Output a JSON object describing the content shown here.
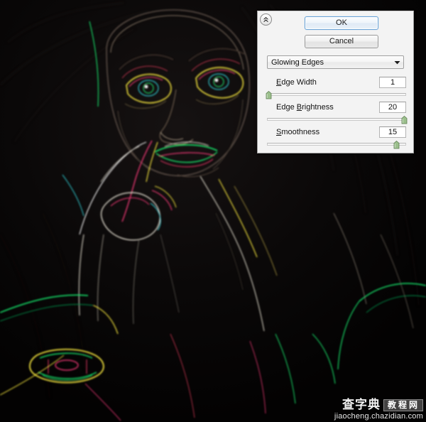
{
  "artwork": {
    "name": "glowing-edges-portrait",
    "description": "Dark portrait photo rendered with the Glowing Edges filter: neon outlines on a black background",
    "background_color": "#060505",
    "edge_colors": [
      "#19e36a",
      "#f2e23c",
      "#e0356e",
      "#4ad7e0",
      "#f27d1e",
      "#ffffff"
    ]
  },
  "watermark": {
    "brand_cn": "查字典",
    "tag_cn": "教程网",
    "url": "jiaocheng.chazidian.com"
  },
  "filter_dialog": {
    "collapse_icon": "double-chevron-up-icon",
    "buttons": {
      "ok_label": "OK",
      "cancel_label": "Cancel",
      "ok_accent_color": "#6ba3d6"
    },
    "filter_select": {
      "selected": "Glowing Edges",
      "arrow_icon": "chevron-down-icon"
    },
    "controls": [
      {
        "id": "edge-width",
        "label_before": "",
        "label_accel": "E",
        "label_after": "dge Width",
        "label_full": "Edge Width",
        "value": "1",
        "slider_percent": 1,
        "min": 1,
        "max": 14
      },
      {
        "id": "edge-brightness",
        "label_before": "Edge ",
        "label_accel": "B",
        "label_after": "rightness",
        "label_full": "Edge Brightness",
        "value": "20",
        "slider_percent": 99,
        "min": 0,
        "max": 20
      },
      {
        "id": "smoothness",
        "label_before": "",
        "label_accel": "S",
        "label_after": "moothness",
        "label_full": "Smoothness",
        "value": "15",
        "slider_percent": 93,
        "min": 1,
        "max": 15
      }
    ]
  }
}
